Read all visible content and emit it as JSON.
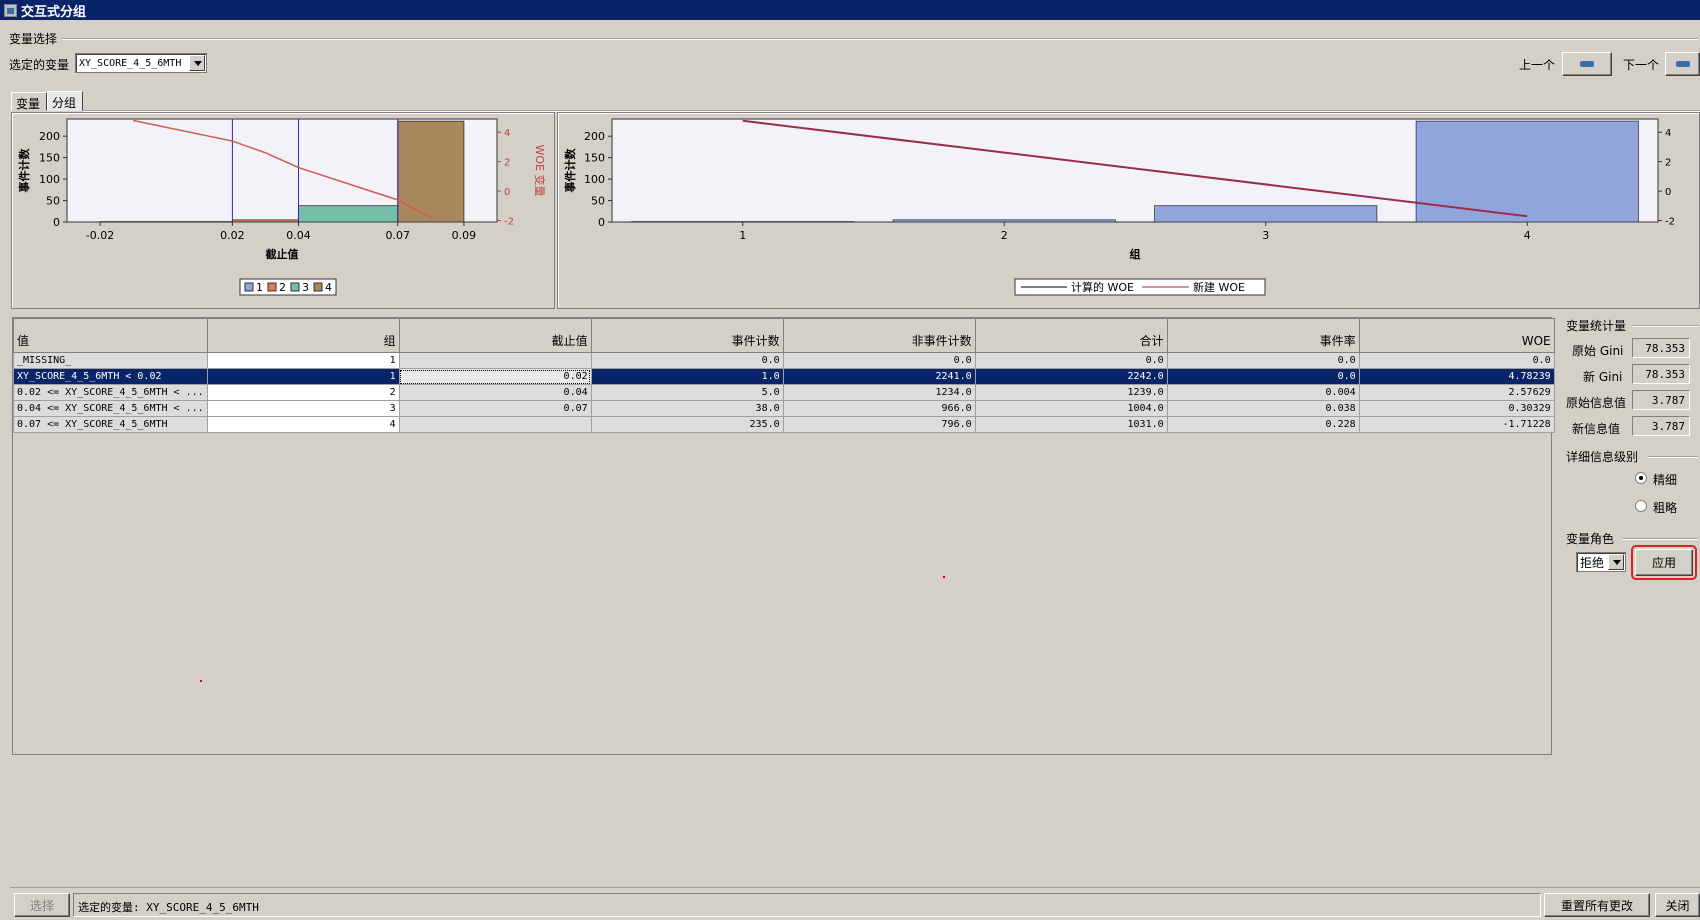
{
  "window": {
    "title": "交互式分组"
  },
  "var_select": {
    "section": "变量选择",
    "selected_label": "选定的变量",
    "selected_value": "XY_SCORE_4_5_6MTH",
    "prev_label": "上一个",
    "next_label": "下一个"
  },
  "tabs": [
    {
      "label": "变量"
    },
    {
      "label": "分组"
    }
  ],
  "chart_data": [
    {
      "type": "bar",
      "xlabel": "截止值",
      "ylabel": "事件计数",
      "y2label": "WOE 变量",
      "xticks": [
        -0.02,
        0.02,
        0.04,
        0.07,
        0.09
      ],
      "yticks": [
        0,
        50,
        100,
        150,
        200
      ],
      "y2ticks": [
        -2,
        0,
        2,
        4
      ],
      "ylim": [
        0,
        240
      ],
      "y2lim": [
        -2.1,
        4.9
      ],
      "cutoffs": [
        0.02,
        0.04,
        0.07
      ],
      "series": [
        {
          "name": "1",
          "x_range": [
            -0.02,
            0.02
          ],
          "value": 1,
          "color": "#8ea4d8"
        },
        {
          "name": "2",
          "x_range": [
            0.02,
            0.04
          ],
          "value": 5,
          "color": "#e07b55"
        },
        {
          "name": "3",
          "x_range": [
            0.04,
            0.07
          ],
          "value": 38,
          "color": "#73bfa8"
        },
        {
          "name": "4",
          "x_range": [
            0.07,
            0.09
          ],
          "value": 235,
          "color": "#a8875a"
        }
      ],
      "woe_line": {
        "x": [
          -0.01,
          0.02,
          0.03,
          0.04,
          0.07,
          0.08
        ],
        "y": [
          4.8,
          3.4,
          2.6,
          1.6,
          -0.6,
          -1.8
        ],
        "color": "#cf5a4e"
      },
      "legend": [
        "1",
        "2",
        "3",
        "4"
      ]
    },
    {
      "type": "bar",
      "xlabel": "组",
      "ylabel": "事件计数",
      "categories": [
        "1",
        "2",
        "3",
        "4"
      ],
      "values": [
        1,
        5,
        38,
        235
      ],
      "yticks": [
        0,
        50,
        100,
        150,
        200
      ],
      "y2ticks": [
        -2,
        0,
        2,
        4
      ],
      "ylim": [
        0,
        240
      ],
      "y2lim": [
        -2.1,
        4.9
      ],
      "bar_color": "#8fa5dc",
      "woe_line": {
        "name": "新建 WOE",
        "x": [
          1,
          4
        ],
        "y": [
          4.78,
          -1.71
        ],
        "color": "#9b2d4a"
      },
      "legend": [
        "计算的 WOE",
        "新建 WOE"
      ]
    }
  ],
  "grid": {
    "columns": [
      "值",
      "组",
      "截止值",
      "事件计数",
      "非事件计数",
      "合计",
      "事件率",
      "WOE"
    ],
    "rows": [
      [
        "_MISSING_",
        "1",
        "",
        "0.0",
        "0.0",
        "0.0",
        "0.0",
        "0.0"
      ],
      [
        "XY_SCORE_4_5_6MTH < 0.02",
        "1",
        "0.02",
        "1.0",
        "2241.0",
        "2242.0",
        "0.0",
        "4.78239"
      ],
      [
        "0.02 <= XY_SCORE_4_5_6MTH < ...",
        "2",
        "0.04",
        "5.0",
        "1234.0",
        "1239.0",
        "0.004",
        "2.57629"
      ],
      [
        "0.04 <= XY_SCORE_4_5_6MTH < ...",
        "3",
        "0.07",
        "38.0",
        "966.0",
        "1004.0",
        "0.038",
        "0.30329"
      ],
      [
        "0.07 <= XY_SCORE_4_5_6MTH",
        "4",
        "",
        "235.0",
        "796.0",
        "1031.0",
        "0.228",
        "-1.71228"
      ]
    ],
    "selected_row": 1
  },
  "stats": {
    "section": "变量统计量",
    "orig_gini_label": "原始 Gini",
    "orig_gini": "78.353",
    "new_gini_label": "新 Gini",
    "new_gini": "78.353",
    "orig_iv_label": "原始信息值",
    "orig_iv": "3.787",
    "new_iv_label": "新信息值",
    "new_iv": "3.787"
  },
  "detail": {
    "section": "详细信息级别",
    "fine": "精细",
    "coarse": "粗略",
    "selected": "精细"
  },
  "role": {
    "section": "变量角色",
    "value": "拒绝",
    "apply": "应用"
  },
  "status": {
    "select_button": "选择",
    "selected_text": "选定的变量: XY_SCORE_4_5_6MTH",
    "reset_button": "重置所有更改",
    "close_button": "关闭"
  }
}
